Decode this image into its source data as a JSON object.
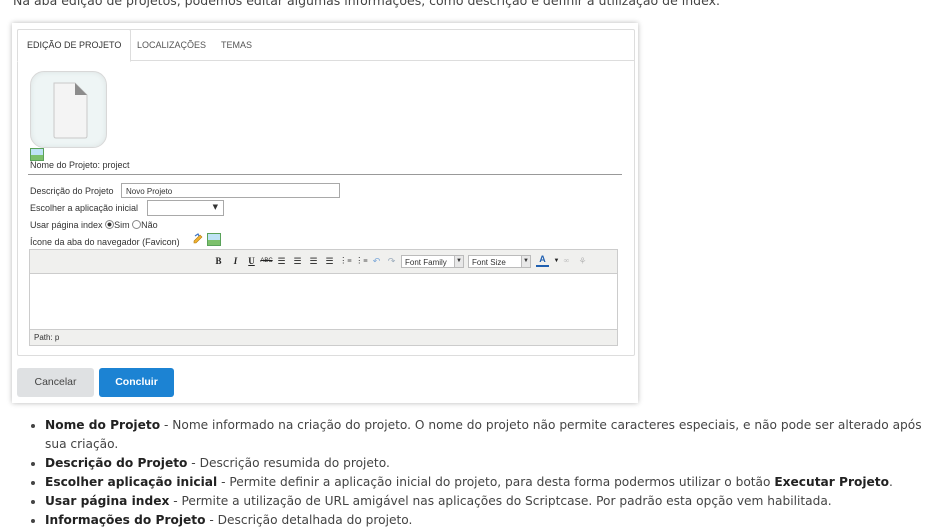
{
  "intro_text": "Na aba edição de projetos, podemos editar algumas informações, como descrição e definir a utilização de index.",
  "tabs": [
    {
      "label": "EDIÇÃO DE PROJETO",
      "active": true
    },
    {
      "label": "LOCALIZAÇÕES",
      "active": false
    },
    {
      "label": "TEMAS",
      "active": false
    }
  ],
  "form": {
    "project_name_label": "Nome do Projeto: project",
    "description_label": "Descrição do Projeto",
    "description_value": "Novo Projeto",
    "initial_app_label": "Escolher a aplicação inicial",
    "initial_app_value": "",
    "use_index_label": "Usar página index",
    "radio_yes": "Sim",
    "radio_no": "Não",
    "favicon_label": "Ícone da aba do navegador (Favicon)"
  },
  "editor": {
    "font_family": "Font Family",
    "font_size": "Font Size",
    "path": "Path: p"
  },
  "buttons": {
    "cancel": "Cancelar",
    "confirm": "Concluir"
  },
  "bullets": [
    {
      "term": "Nome do Projeto",
      "text": " - Nome informado na criação do projeto. O nome do projeto não permite caracteres especiais, e não pode ser alterado após sua criação."
    },
    {
      "term": "Descrição do Projeto",
      "text": " - Descrição resumida do projeto."
    },
    {
      "term": "Escolher aplicação inicial",
      "text": " - Permite definir a aplicação inicial do projeto, para desta forma podermos utilizar o botão ",
      "term2": "Executar Projeto",
      "text2": "."
    },
    {
      "term": "Usar página index",
      "text": " - Permite a utilização de URL amigável nas aplicações do Scriptcase. Por padrão esta opção vem habilitada."
    },
    {
      "term": "Informações do Projeto",
      "text": " - Descrição detalhada do projeto."
    }
  ]
}
